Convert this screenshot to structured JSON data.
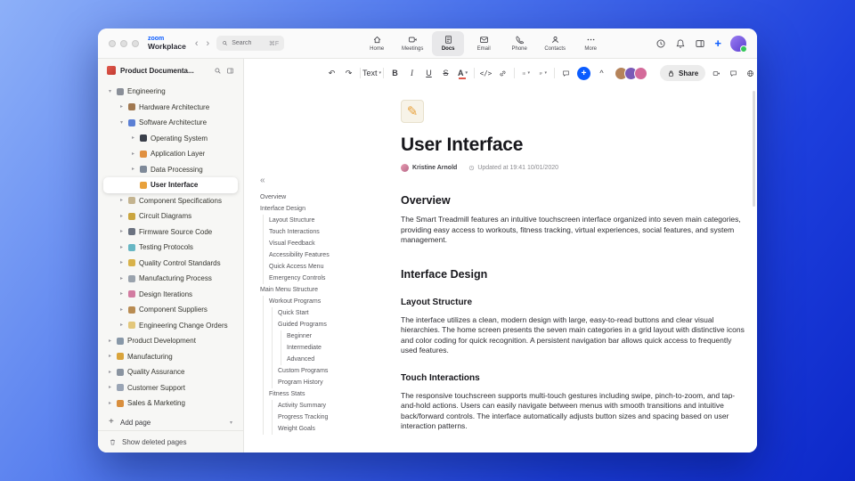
{
  "colors": {
    "accent": "#0B5CFF",
    "status_online": "#34C759"
  },
  "glyphs": {
    "back": "‹",
    "forward": "›",
    "chevron_right": "▸",
    "chevron_down": "▾",
    "outline_collapse": "«",
    "undo": "↶",
    "redo": "↷",
    "collapse": "^",
    "more_dots": "···",
    "globe": "⊕",
    "plus": "+",
    "add_plus": "+",
    "doc_icon": "✎"
  },
  "titlebar": {
    "logo_top": "zoom",
    "logo_bottom": "Workplace",
    "search_placeholder": "Search",
    "search_shortcut": "⌘F",
    "tabs": [
      {
        "label": "Home",
        "icon": "home"
      },
      {
        "label": "Meetings",
        "icon": "video"
      },
      {
        "label": "Docs",
        "icon": "doc",
        "active": true
      },
      {
        "label": "Email",
        "icon": "mail"
      },
      {
        "label": "Phone",
        "icon": "phone"
      },
      {
        "label": "Contacts",
        "icon": "contacts"
      },
      {
        "label": "More",
        "icon": "more"
      }
    ],
    "right_icons": [
      "clock-icon",
      "bell-icon",
      "panel-icon",
      "plus-icon",
      "user-avatar"
    ]
  },
  "sidebar": {
    "title": "Product Documenta...",
    "items": [
      {
        "label": "Engineering",
        "level": 0,
        "chevron": "down",
        "icon": "gear",
        "icon_color": "#8a8f98"
      },
      {
        "label": "Hardware Architecture",
        "level": 1,
        "chevron": "right",
        "icon": "chip",
        "icon_color": "#a07850"
      },
      {
        "label": "Software Architecture",
        "level": 1,
        "chevron": "down",
        "icon": "code",
        "icon_color": "#5b7fd4"
      },
      {
        "label": "Operating System",
        "level": 2,
        "chevron": "right",
        "icon": "device",
        "icon_color": "#3a3f4a"
      },
      {
        "label": "Application Layer",
        "level": 2,
        "chevron": "right",
        "icon": "box",
        "icon_color": "#e09040"
      },
      {
        "label": "Data Processing",
        "level": 2,
        "chevron": "right",
        "icon": "chart",
        "icon_color": "#7f8a99"
      },
      {
        "label": "User Interface",
        "level": 2,
        "chevron": "none",
        "icon": "pencil",
        "icon_color": "#e8a13c",
        "selected": true
      },
      {
        "label": "Component Specifications",
        "level": 1,
        "chevron": "right",
        "icon": "clipboard",
        "icon_color": "#c4b490"
      },
      {
        "label": "Circuit Diagrams",
        "level": 1,
        "chevron": "right",
        "icon": "circuit",
        "icon_color": "#caa53f"
      },
      {
        "label": "Firmware Source Code",
        "level": 1,
        "chevron": "right",
        "icon": "disk",
        "icon_color": "#6b7280"
      },
      {
        "label": "Testing Protocols",
        "level": 1,
        "chevron": "right",
        "icon": "flask",
        "icon_color": "#67b7c4"
      },
      {
        "label": "Quality Control Standards",
        "level": 1,
        "chevron": "right",
        "icon": "medal",
        "icon_color": "#d8b24a"
      },
      {
        "label": "Manufacturing Process",
        "level": 1,
        "chevron": "right",
        "icon": "factory",
        "icon_color": "#9aa3ad"
      },
      {
        "label": "Design Iterations",
        "level": 1,
        "chevron": "right",
        "icon": "palette",
        "icon_color": "#d27ba0"
      },
      {
        "label": "Component Suppliers",
        "level": 1,
        "chevron": "right",
        "icon": "truck",
        "icon_color": "#b98c52"
      },
      {
        "label": "Engineering Change Orders",
        "level": 1,
        "chevron": "right",
        "icon": "memo",
        "icon_color": "#e3c77a"
      },
      {
        "label": "Product Development",
        "level": 0,
        "chevron": "right",
        "icon": "rocket",
        "icon_color": "#8898a8"
      },
      {
        "label": "Manufacturing",
        "level": 0,
        "chevron": "right",
        "icon": "hammer",
        "icon_color": "#d9a43b"
      },
      {
        "label": "Quality Assurance",
        "level": 0,
        "chevron": "right",
        "icon": "shield",
        "icon_color": "#8a94a0"
      },
      {
        "label": "Customer Support",
        "level": 0,
        "chevron": "right",
        "icon": "chat",
        "icon_color": "#9aa5b5"
      },
      {
        "label": "Sales & Marketing",
        "level": 0,
        "chevron": "right",
        "icon": "chart-up",
        "icon_color": "#d98f3e"
      }
    ],
    "add_page": "Add page",
    "show_deleted": "Show deleted pages"
  },
  "outline": {
    "items": [
      {
        "label": "Overview",
        "level": 0
      },
      {
        "label": "Interface Design",
        "level": 0
      },
      {
        "label": "Layout Structure",
        "level": 1
      },
      {
        "label": "Touch Interactions",
        "level": 1
      },
      {
        "label": "Visual Feedback",
        "level": 1
      },
      {
        "label": "Accessibility Features",
        "level": 1
      },
      {
        "label": "Quick Access Menu",
        "level": 1
      },
      {
        "label": "Emergency Controls",
        "level": 1
      },
      {
        "label": "Main Menu Structure",
        "level": 0
      },
      {
        "label": "Workout Programs",
        "level": 1
      },
      {
        "label": "Quick Start",
        "level": 2
      },
      {
        "label": "Guided Programs",
        "level": 2
      },
      {
        "label": "Beginner",
        "level": 3
      },
      {
        "label": "Intermediate",
        "level": 3
      },
      {
        "label": "Advanced",
        "level": 3
      },
      {
        "label": "Custom Programs",
        "level": 2
      },
      {
        "label": "Program History",
        "level": 2
      },
      {
        "label": "Fitness Stats",
        "level": 1
      },
      {
        "label": "Activity Summary",
        "level": 2
      },
      {
        "label": "Progress Tracking",
        "level": 2
      },
      {
        "label": "Weight Goals",
        "level": 2
      }
    ]
  },
  "toolbar": {
    "text_style": "Text",
    "bold": "B",
    "italic": "I",
    "underline": "U",
    "strikethrough": "S",
    "color": "A",
    "code": "</>",
    "share": "Share",
    "avatars": [
      {
        "name": "collaborator-1",
        "color": "#b5835a"
      },
      {
        "name": "collaborator-2",
        "color": "#7a5ab7"
      },
      {
        "name": "collaborator-3",
        "color": "#d46a9a"
      }
    ]
  },
  "doc": {
    "title": "User Interface",
    "author": "Kristine Arnold",
    "updated": "Updated at 19:41 10/01/2020",
    "sections": [
      {
        "type": "h2",
        "text": "Overview"
      },
      {
        "type": "p",
        "text": "The Smart Treadmill features an intuitive touchscreen interface organized into seven main categories, providing easy access to workouts, fitness tracking, virtual experiences, social features, and system management."
      },
      {
        "type": "h2",
        "text": "Interface Design"
      },
      {
        "type": "h3",
        "text": "Layout Structure"
      },
      {
        "type": "p",
        "text": "The interface utilizes a clean, modern design with large, easy-to-read buttons and clear visual hierarchies. The home screen presents the seven main categories in a grid layout with distinctive icons and color coding for quick recognition. A persistent navigation bar allows quick access to frequently used features."
      },
      {
        "type": "h3",
        "text": "Touch Interactions"
      },
      {
        "type": "p",
        "text": "The responsive touchscreen supports multi-touch gestures including swipe, pinch-to-zoom, and tap-and-hold actions. Users can easily navigate between menus with smooth transitions and intuitive back/forward controls. The interface automatically adjusts button sizes and spacing based on user interaction patterns."
      }
    ]
  }
}
